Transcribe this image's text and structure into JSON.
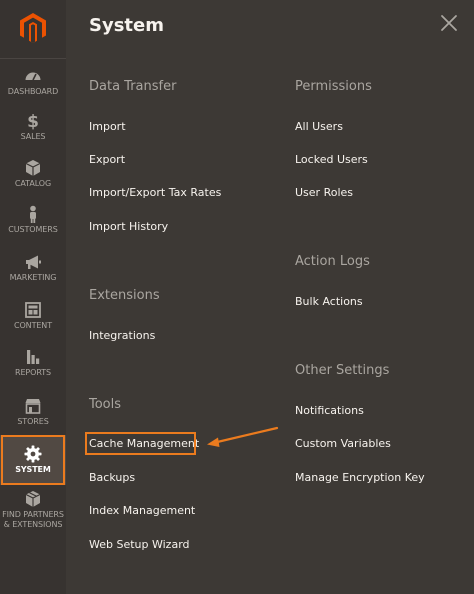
{
  "sidebar": {
    "logo": {
      "icon": "magento-logo-icon",
      "color": "#eb5202"
    },
    "items": [
      {
        "key": "dashboard",
        "label": "DASHBOARD",
        "icon": "gauge-icon"
      },
      {
        "key": "sales",
        "label": "SALES",
        "icon": "dollar-icon"
      },
      {
        "key": "catalog",
        "label": "CATALOG",
        "icon": "cube-icon"
      },
      {
        "key": "customers",
        "label": "CUSTOMERS",
        "icon": "person-icon"
      },
      {
        "key": "marketing",
        "label": "MARKETING",
        "icon": "megaphone-icon"
      },
      {
        "key": "content",
        "label": "CONTENT",
        "icon": "layout-icon"
      },
      {
        "key": "reports",
        "label": "REPORTS",
        "icon": "bar-chart-icon"
      },
      {
        "key": "stores",
        "label": "STORES",
        "icon": "storefront-icon"
      },
      {
        "key": "system",
        "label": "SYSTEM",
        "icon": "gear-icon",
        "active": true
      },
      {
        "key": "partners",
        "label": "FIND PARTNERS & EXTENSIONS",
        "icon": "box-icon"
      }
    ]
  },
  "panel": {
    "title": "System",
    "close_icon": "close-icon",
    "columns": [
      {
        "sections": [
          {
            "title": "Data Transfer",
            "links": [
              "Import",
              "Export",
              "Import/Export Tax Rates",
              "Import History"
            ]
          },
          {
            "title": "Extensions",
            "links": [
              "Integrations"
            ]
          },
          {
            "title": "Tools",
            "links": [
              "Cache Management",
              "Backups",
              "Index Management",
              "Web Setup Wizard"
            ]
          }
        ]
      },
      {
        "sections": [
          {
            "title": "Permissions",
            "links": [
              "All Users",
              "Locked Users",
              "User Roles"
            ]
          },
          {
            "title": "Action Logs",
            "links": [
              "Bulk Actions"
            ]
          },
          {
            "title": "Other Settings",
            "links": [
              "Notifications",
              "Custom Variables",
              "Manage Encryption Key"
            ]
          }
        ]
      }
    ],
    "highlighted_link": "Cache Management"
  },
  "colors": {
    "accent_orange": "#eb7b1e",
    "sidebar_bg": "#373330",
    "panel_bg": "#3d3935",
    "text_light": "#f7f3ee",
    "text_muted": "#aaa6a0"
  }
}
